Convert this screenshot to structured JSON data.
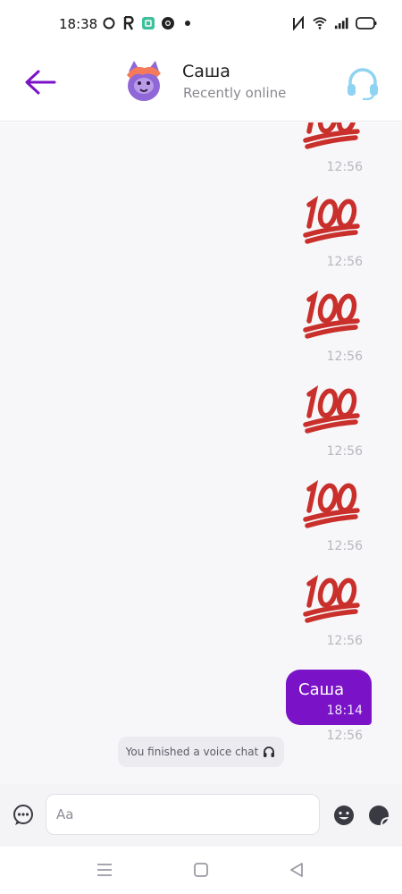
{
  "status_bar": {
    "time": "18:38",
    "left_icons": [
      "sync-icon",
      "p-icon",
      "app-icon",
      "chrome-icon",
      "dot-icon"
    ],
    "right_icons": [
      "nfc-icon",
      "wifi-icon",
      "signal-icon",
      "battery-icon"
    ]
  },
  "header": {
    "contact_name": "Саша",
    "contact_status": "Recently online",
    "accent_color": "#7a13c8",
    "voice_icon_color": "#8fd3f2"
  },
  "messages": {
    "emoji_items": [
      {
        "emoji": "💯",
        "time": "12:56"
      },
      {
        "emoji": "💯",
        "time": "12:56"
      },
      {
        "emoji": "💯",
        "time": "12:56"
      },
      {
        "emoji": "💯",
        "time": "12:56"
      },
      {
        "emoji": "💯",
        "time": "12:56"
      },
      {
        "emoji": "💯",
        "time": "12:56"
      },
      {
        "emoji": "💯",
        "time": "12:56"
      }
    ],
    "last_bubble": {
      "text": "Саша",
      "time": "18:14"
    },
    "system_note": "You finished a voice chat"
  },
  "composer": {
    "placeholder": "Aa"
  }
}
